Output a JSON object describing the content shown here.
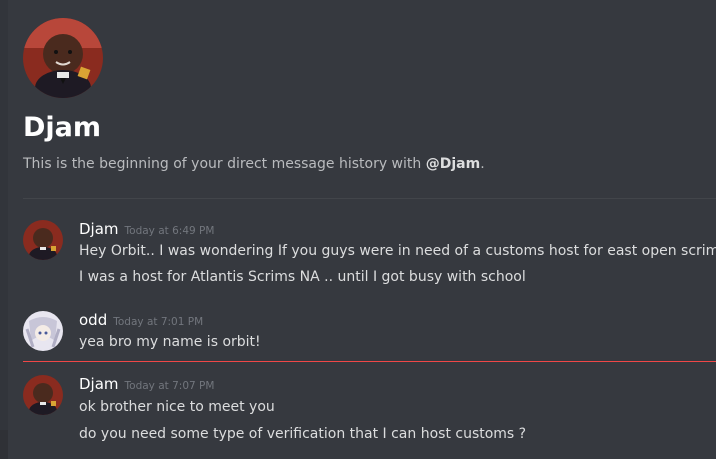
{
  "dm_header": {
    "name": "Djam",
    "intro_prefix": "This is the beginning of your direct message history with ",
    "intro_mention": "@Djam",
    "intro_suffix": "."
  },
  "messages": [
    {
      "username": "Djam",
      "timestamp": "Today at 6:49 PM",
      "lines": [
        "Hey Orbit.. I was wondering If you guys were in need of a customs host for east open scrims",
        "I was a host for Atlantis Scrims NA .. until I got busy with school"
      ]
    },
    {
      "username": "odd",
      "timestamp": "Today at 7:01 PM",
      "lines": [
        "yea bro my name is orbit!"
      ]
    },
    {
      "username": "Djam",
      "timestamp": "Today at 7:07 PM",
      "lines": [
        "ok brother nice to meet you",
        "do you need some type of verification that I can host customs ?"
      ]
    }
  ],
  "colors": {
    "background": "#36393f",
    "new_messages_divider": "#f04747",
    "username": "#ffffff",
    "timestamp": "#72767d"
  }
}
